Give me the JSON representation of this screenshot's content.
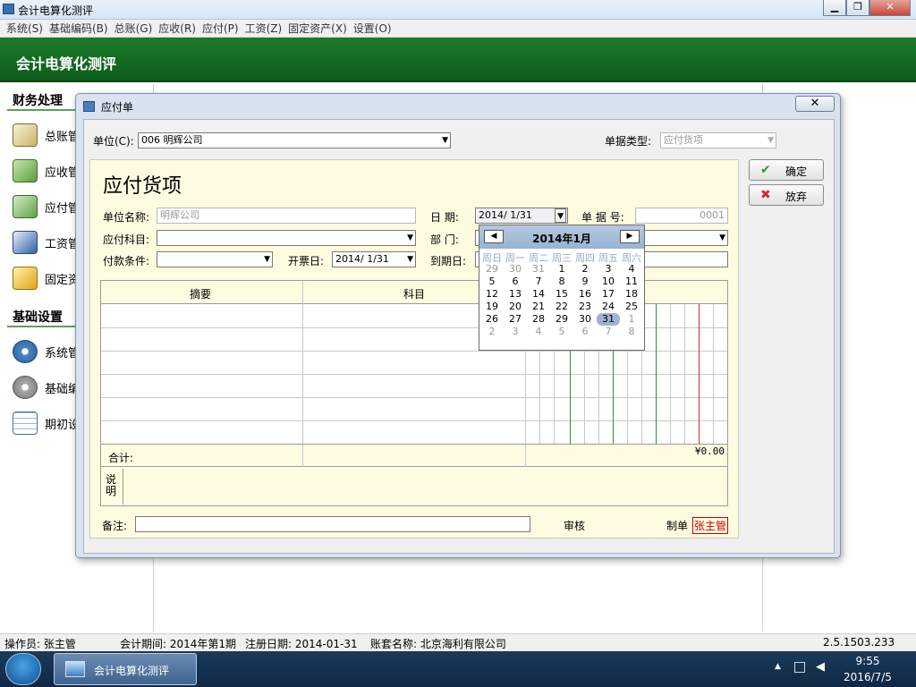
{
  "window": {
    "title": "会计电算化测评",
    "btn_min": "▁",
    "btn_max": "❐",
    "btn_close": "✕"
  },
  "menu": [
    "系统(S)",
    "基础编码(B)",
    "总账(G)",
    "应收(R)",
    "应付(P)",
    "工资(Z)",
    "固定资产(X)",
    "设置(O)"
  ],
  "banner": {
    "title": "会计电算化测评"
  },
  "sidebar": {
    "finance_title": "财务处理",
    "finance_items": [
      {
        "label": "总账管",
        "icon": "ledger-icon"
      },
      {
        "label": "应收管",
        "icon": "receivable-icon"
      },
      {
        "label": "应付管",
        "icon": "payable-icon"
      },
      {
        "label": "工资管",
        "icon": "payroll-icon"
      },
      {
        "label": "固定资",
        "icon": "asset-icon"
      }
    ],
    "base_title": "基础设置",
    "base_items": [
      {
        "label": "系统管",
        "icon": "system-gear-icon"
      },
      {
        "label": "基础编",
        "icon": "base-gear-icon"
      },
      {
        "label": "期初设",
        "icon": "opening-sheet-icon"
      }
    ]
  },
  "dialog": {
    "title": "应付单",
    "close_label": "✕",
    "unit_label": "单位(C):",
    "unit_value": "006 明辉公司",
    "doc_type_label": "单据类型:",
    "doc_type_value": "应付货项",
    "ok_label": "确定",
    "cancel_label": "放弃",
    "form": {
      "heading": "应付货项",
      "unit_name_label": "单位名称:",
      "unit_name_value": "明辉公司",
      "date_label": "日  期:",
      "date_value": "2014/ 1/31",
      "doc_no_label": "单 据 号:",
      "doc_no_value": "0001",
      "account_label": "应付科目:",
      "dept_label": "部  门:",
      "terms_label": "付款条件:",
      "invoice_label": "开票日:",
      "invoice_value": "2014/ 1/31",
      "due_label": "到期日:",
      "col_summary": "摘要",
      "col_subject": "科目",
      "total_label": "合计:",
      "total_value": "¥0.00",
      "note_label": "说明",
      "remark_label": "备注:",
      "review_label": "审核",
      "maker_label": "制单",
      "maker_value": "张主管"
    }
  },
  "calendar": {
    "month_label": "2014年1月",
    "weekdays": [
      "周日",
      "周一",
      "周二",
      "周三",
      "周四",
      "周五",
      "周六"
    ],
    "weeks": [
      [
        "29",
        "30",
        "31",
        "1",
        "2",
        "3",
        "4"
      ],
      [
        "5",
        "6",
        "7",
        "8",
        "9",
        "10",
        "11"
      ],
      [
        "12",
        "13",
        "14",
        "15",
        "16",
        "17",
        "18"
      ],
      [
        "19",
        "20",
        "21",
        "22",
        "23",
        "24",
        "25"
      ],
      [
        "26",
        "27",
        "28",
        "29",
        "30",
        "31",
        "1"
      ],
      [
        "2",
        "3",
        "4",
        "5",
        "6",
        "7",
        "8"
      ]
    ],
    "selected_day": "31",
    "prev_label": "◀",
    "next_label": "▶"
  },
  "status": {
    "operator": "操作员: 张主管",
    "period": "会计期间: 2014年第1期",
    "reg_date": "注册日期: 2014-01-31",
    "account_set": "账套名称: 北京海利有限公司",
    "version": "2.5.1503.233"
  },
  "taskbar": {
    "app_label": "会计电算化测评",
    "time": "9:55",
    "date": "2016/7/5"
  }
}
